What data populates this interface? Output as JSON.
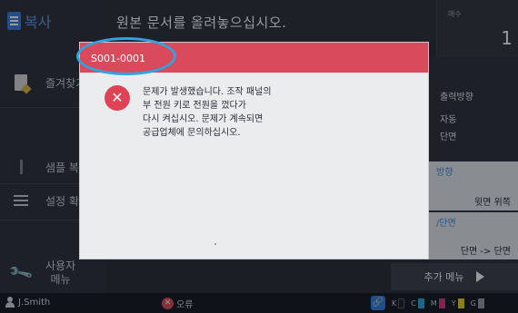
{
  "app": {
    "title": "복사"
  },
  "header": {
    "message": "원본 문서를 올려놓으십시오."
  },
  "copies": {
    "label": "매수",
    "value": "1"
  },
  "sidebar": {
    "items": [
      {
        "label": "즐겨찾기",
        "icon": "favorite-icon"
      },
      {
        "label": "샘플 복사",
        "icon": "sample-copy-icon"
      },
      {
        "label": "설정 확인",
        "icon": "list-icon"
      },
      {
        "label": "사용자\n메뉴",
        "icon": "wrench-icon"
      }
    ]
  },
  "settings": {
    "output_method_label": "출력방향",
    "output_auto": "자동",
    "output_sides": "단면",
    "orientation_label": "방향",
    "orientation_value": "윗면 위쪽",
    "duplex_label": "/단면",
    "duplex_value": "단면 -> 단면"
  },
  "more_menu": {
    "label": "추가 메뉴"
  },
  "status": {
    "user": "J.Smith",
    "error": "오류",
    "ink": [
      {
        "letter": "K",
        "color": "#1a1a1a"
      },
      {
        "letter": "C",
        "color": "#2aa8e0"
      },
      {
        "letter": "M",
        "color": "#d6357f"
      },
      {
        "letter": "Y",
        "color": "#e8d21e"
      },
      {
        "letter": "G",
        "color": "#9a9a9a"
      }
    ]
  },
  "dialog": {
    "code": "S001-0001",
    "lines": [
      "문제가 발생했습니다. 조작 패널의",
      "부 전원 키로 전원을 껐다가",
      "다시 켜십시오. 문제가 계속되면",
      "공급업체에 문의하십시오."
    ],
    "title_color": "#d94a5c",
    "highlight_color": "#2ea5e0"
  }
}
